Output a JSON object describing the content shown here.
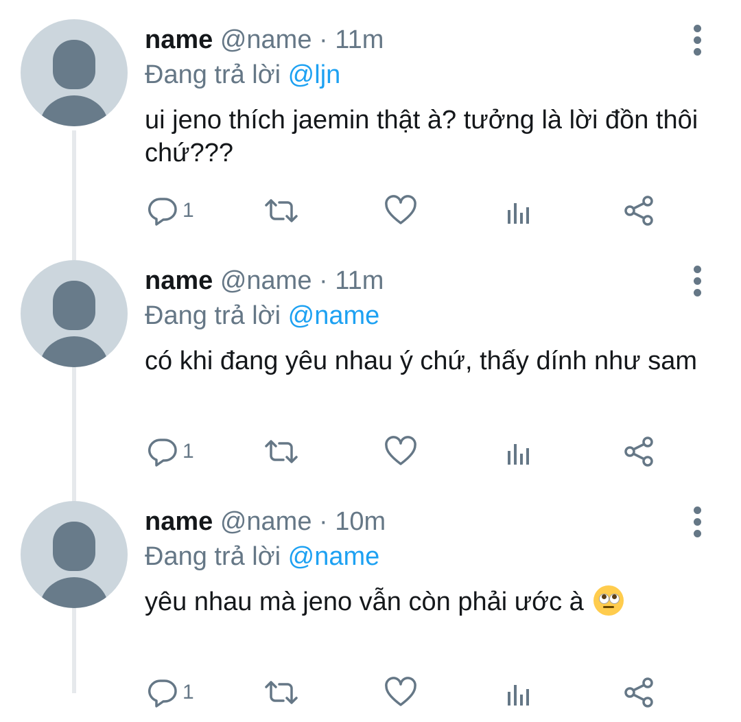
{
  "tweets": [
    {
      "display_name": "name",
      "handle": "@name",
      "dot": "·",
      "time": "11m",
      "reply_prefix": "Đang trả lời",
      "reply_mention": "@ljn",
      "text": "ui jeno thích jaemin thật à? tưởng là lời đồn thôi chứ???",
      "reply_count": "1"
    },
    {
      "display_name": "name",
      "handle": "@name",
      "dot": "·",
      "time": "11m",
      "reply_prefix": "Đang trả lời",
      "reply_mention": "@name",
      "text": "có khi đang yêu nhau ý chứ, thấy dính như sam",
      "reply_count": "1"
    },
    {
      "display_name": "name",
      "handle": "@name",
      "dot": "·",
      "time": "10m",
      "reply_prefix": "Đang trả lời",
      "reply_mention": "@name",
      "text": "yêu nhau mà jeno vẫn còn phải ước à",
      "emoji": "face-with-rolling-eyes",
      "reply_count": "1"
    }
  ],
  "colors": {
    "secondary_text": "#657786",
    "mention": "#1da1f2",
    "avatar_bg": "#ccd6dd",
    "avatar_fg": "#687b8a"
  }
}
